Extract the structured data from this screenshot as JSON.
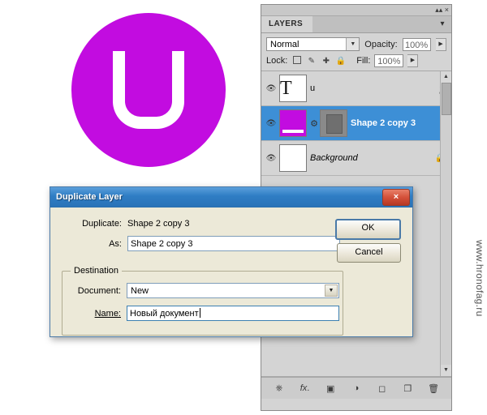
{
  "logo": {
    "name": "uplay-logo",
    "circle_color": "#c20ce0",
    "letter": "U"
  },
  "watermark": {
    "text": "www.hronofag.ru"
  },
  "layers_panel": {
    "tab_label": "LAYERS",
    "menu_icon": "▾",
    "collapse_icons": "▴▴ ×",
    "blend_mode": "Normal",
    "opacity_label": "Opacity:",
    "opacity_value": "100%",
    "lock_label": "Lock:",
    "lock_icons": [
      "transparency-lock",
      "brush-lock",
      "move-lock",
      "all-lock"
    ],
    "fill_label": "Fill:",
    "fill_value": "100%",
    "layers": [
      {
        "name": "u",
        "thumb": "text-T",
        "visible": true,
        "selected": false,
        "effects": "fx",
        "style": "normal"
      },
      {
        "name": "Shape 2 copy 3",
        "thumb": "purple-shape",
        "has_mask": true,
        "visible": true,
        "selected": true,
        "style": "bold"
      },
      {
        "name": "Background",
        "thumb": "white",
        "visible": true,
        "selected": false,
        "locked": true,
        "style": "italic"
      }
    ],
    "footer_icons": [
      "link-layers",
      "layer-style-fx",
      "add-mask",
      "adjustment-layer",
      "new-group",
      "new-layer",
      "delete-layer"
    ]
  },
  "dialog": {
    "title": "Duplicate Layer",
    "close_label": "×",
    "duplicate_label": "Duplicate:",
    "duplicate_value": "Shape 2 copy 3",
    "as_label": "As:",
    "as_value": "Shape 2 copy 3",
    "destination_legend": "Destination",
    "document_label": "Document:",
    "document_value": "New",
    "name_label": "Name:",
    "name_value": "Новый документ",
    "ok_label": "OK",
    "cancel_label": "Cancel"
  }
}
